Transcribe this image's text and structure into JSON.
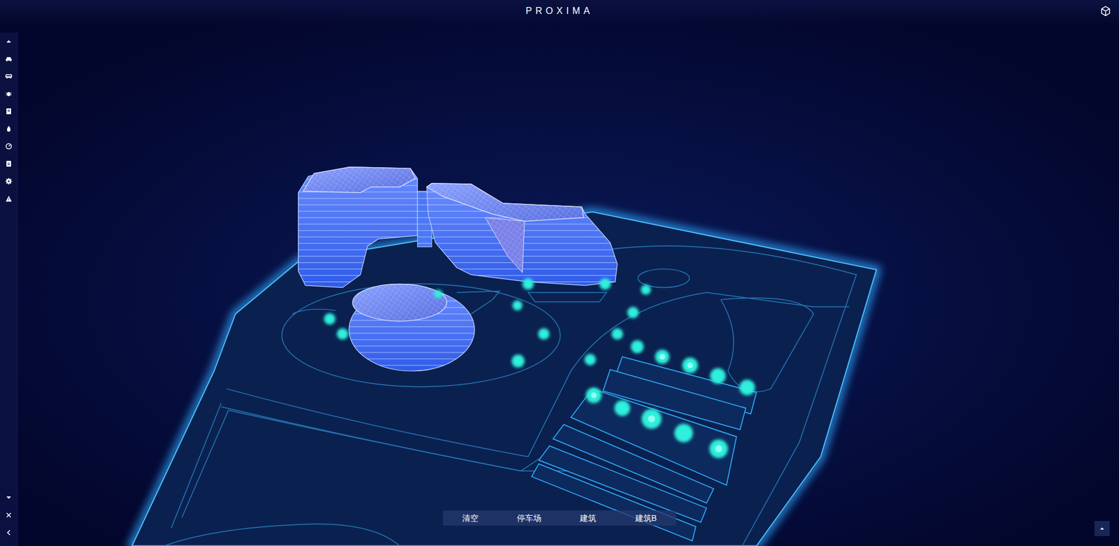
{
  "window": {
    "title": "PROXIMA"
  },
  "toolbar": {
    "buttons": [
      {
        "label": "清空"
      },
      {
        "label": "停车场"
      },
      {
        "label": "建筑"
      },
      {
        "label": "建筑B"
      }
    ]
  }
}
